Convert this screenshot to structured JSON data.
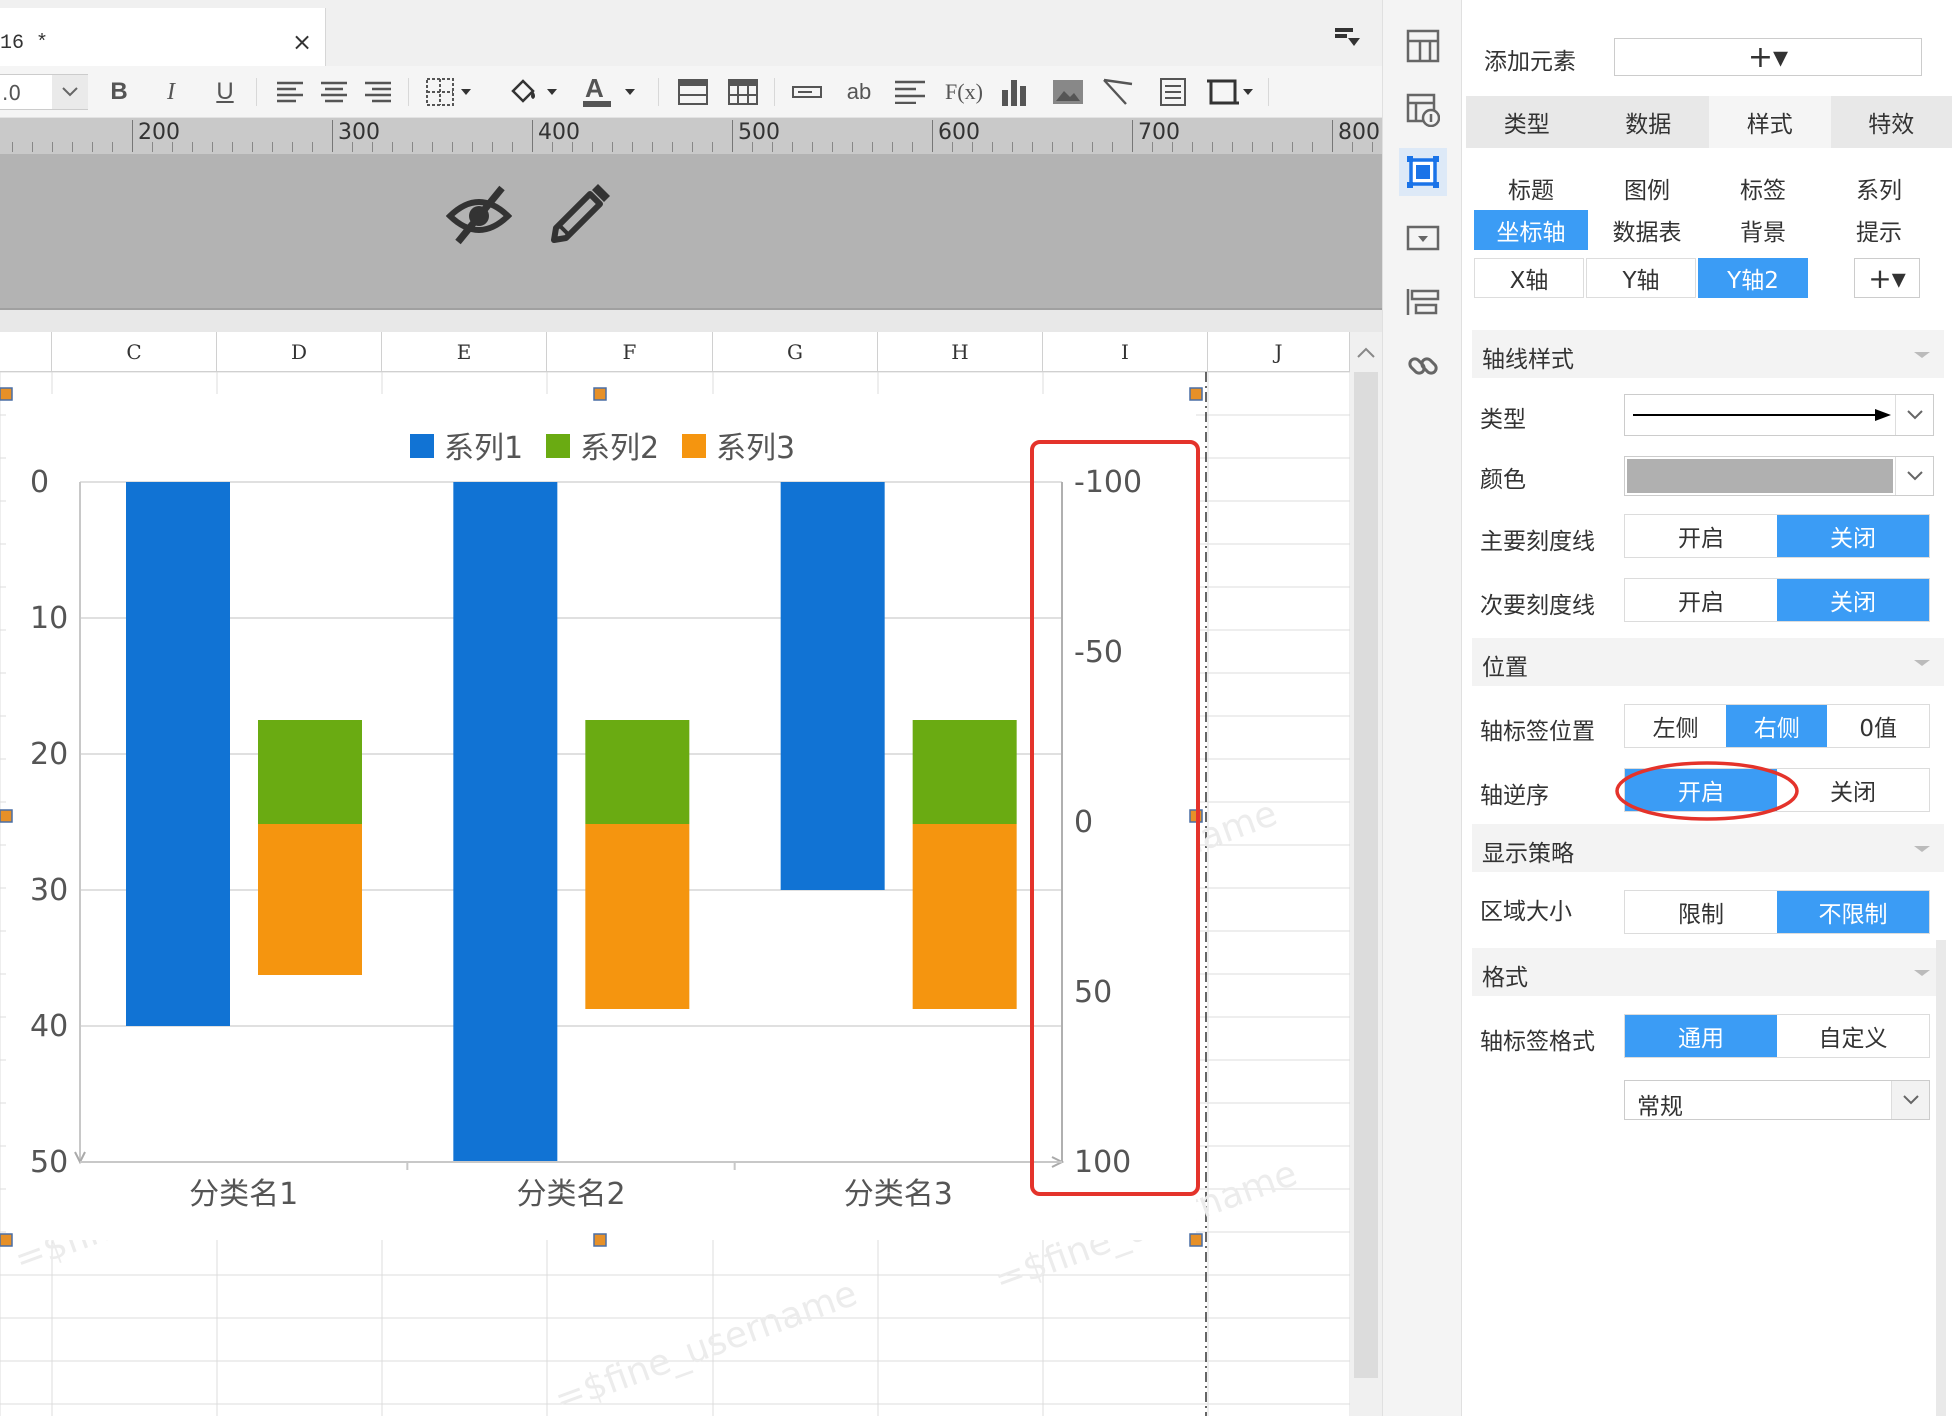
{
  "tab": {
    "title": "16 *",
    "close": "×"
  },
  "toolbar": {
    "font_size": ".0",
    "bold": "B",
    "italic": "I",
    "underline": "U",
    "text_tool": "ab",
    "formula_tool": "F(x)"
  },
  "ruler": {
    "labels": [
      "200",
      "300",
      "400",
      "500",
      "600",
      "700",
      "800"
    ]
  },
  "columns": [
    "C",
    "D",
    "E",
    "F",
    "G",
    "H",
    "I",
    "J"
  ],
  "chart_data": {
    "type": "bar",
    "categories": [
      "分类名1",
      "分类名2",
      "分类名3"
    ],
    "series": [
      {
        "name": "系列1",
        "axis": "y1",
        "color": "#1173d4",
        "values": [
          40,
          50,
          30
        ]
      },
      {
        "name": "系列2",
        "axis": "y2",
        "color": "#6aab12",
        "values": [
          -30,
          -30,
          -30
        ]
      },
      {
        "name": "系列3",
        "axis": "y2",
        "color": "#f5950f",
        "values": [
          45,
          55,
          55
        ]
      }
    ],
    "y1_axis": {
      "ticks": [
        "0",
        "10",
        "20",
        "30",
        "40",
        "50"
      ],
      "range": [
        0,
        50
      ],
      "reversed": true
    },
    "y2_axis": {
      "ticks": [
        "-100",
        "-50",
        "0",
        "50",
        "100"
      ],
      "range": [
        -100,
        100
      ],
      "reversed": true,
      "position": "right",
      "highlighted": true
    },
    "legend_position": "top",
    "grid": true
  },
  "watermark": "=$fine_username",
  "panel": {
    "add_element_label": "添加元素",
    "add_element_button": "+▾",
    "main_tabs": [
      "类型",
      "数据",
      "样式",
      "特效"
    ],
    "style_tabs_row1": [
      "标题",
      "图例",
      "标签",
      "系列"
    ],
    "style_tabs_row2": [
      "坐标轴",
      "数据表",
      "背景",
      "提示"
    ],
    "axis_tabs": [
      "X轴",
      "Y轴",
      "Y轴2"
    ],
    "axis_add": "+▾",
    "sections": {
      "axis_style": "轴线样式",
      "position": "位置",
      "display_strategy": "显示策略",
      "format": "格式"
    },
    "rows": {
      "type_label": "类型",
      "color_label": "颜色",
      "major_tick_label": "主要刻度线",
      "minor_tick_label": "次要刻度线",
      "label_position_label": "轴标签位置",
      "reverse_label": "轴逆序",
      "area_size_label": "区域大小",
      "label_format_label": "轴标签格式"
    },
    "on": "开启",
    "off": "关闭",
    "label_positions": [
      "左侧",
      "右侧",
      "0值"
    ],
    "area_options": [
      "限制",
      "不限制"
    ],
    "format_options": [
      "通用",
      "自定义"
    ],
    "format_select": "常规",
    "colors": {
      "accent": "#3b9cf5",
      "highlight": "#e4332b",
      "axis_line_color": "#b0b0b0"
    }
  }
}
